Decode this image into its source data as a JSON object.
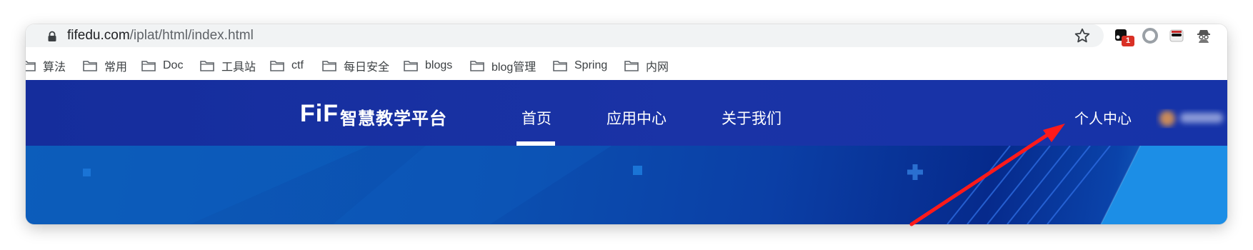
{
  "browser": {
    "url_host": "fifedu.com",
    "url_path": "/iplat/html/index.html",
    "extension_badge": "1",
    "icons": [
      "lock-icon",
      "star-icon",
      "extension-icon",
      "record-icon",
      "incognito-icon",
      "spy-icon"
    ]
  },
  "bookmarks": [
    {
      "label": "算法"
    },
    {
      "label": "常用"
    },
    {
      "label": "Doc"
    },
    {
      "label": "工具站"
    },
    {
      "label": "ctf"
    },
    {
      "label": "每日安全"
    },
    {
      "label": "blogs"
    },
    {
      "label": "blog管理"
    },
    {
      "label": "Spring"
    },
    {
      "label": "内网"
    }
  ],
  "site": {
    "logo_mark": "FiF",
    "logo_text": "智慧教学平台",
    "nav": [
      {
        "label": "首页",
        "active": true
      },
      {
        "label": "应用中心",
        "active": false
      },
      {
        "label": "关于我们",
        "active": false
      }
    ],
    "personal_center": "个人中心"
  },
  "colors": {
    "nav_bg": "#1a33a6",
    "banner_bg": "#0b4fb0",
    "annotation_arrow": "#ff1a1a"
  }
}
